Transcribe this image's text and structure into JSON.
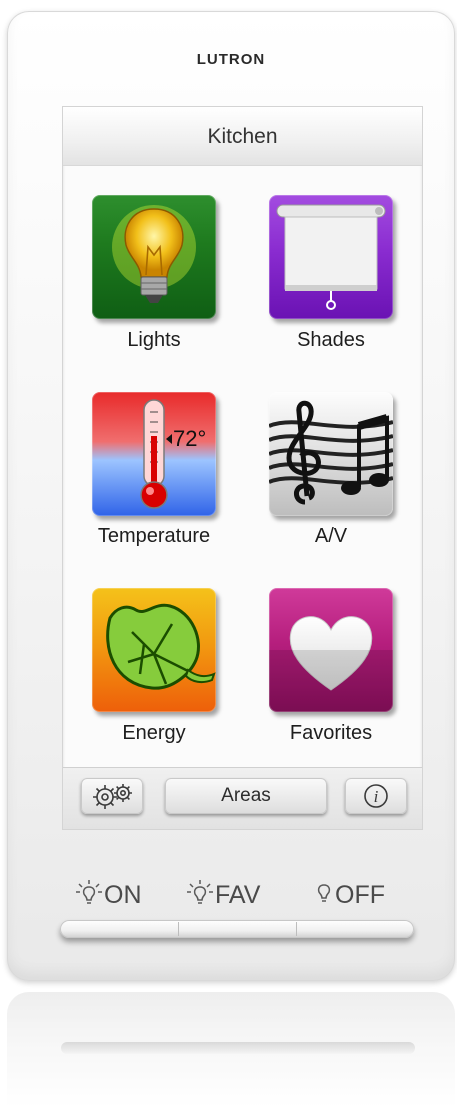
{
  "device": {
    "brand": "LUTRON"
  },
  "screen": {
    "title": "Kitchen",
    "tiles": [
      {
        "label": "Lights",
        "icon": "lightbulb-icon"
      },
      {
        "label": "Shades",
        "icon": "window-shade-icon"
      },
      {
        "label": "Temperature",
        "icon": "thermometer-icon",
        "reading": "72°"
      },
      {
        "label": "A/V",
        "icon": "music-notes-icon"
      },
      {
        "label": "Energy",
        "icon": "leaf-icon"
      },
      {
        "label": "Favorites",
        "icon": "heart-icon"
      }
    ],
    "bottom_bar": {
      "settings_icon": "gears-icon",
      "areas_label": "Areas",
      "info_icon": "info-icon"
    }
  },
  "hardware_buttons": {
    "on_label": "ON",
    "fav_label": "FAV",
    "off_label": "OFF"
  },
  "colors": {
    "lights_tile": "#1e7a1e",
    "shades_tile": "#8a2cd0",
    "energy_tile": "#f29a10",
    "favorites_tile": "#b51e7d"
  }
}
